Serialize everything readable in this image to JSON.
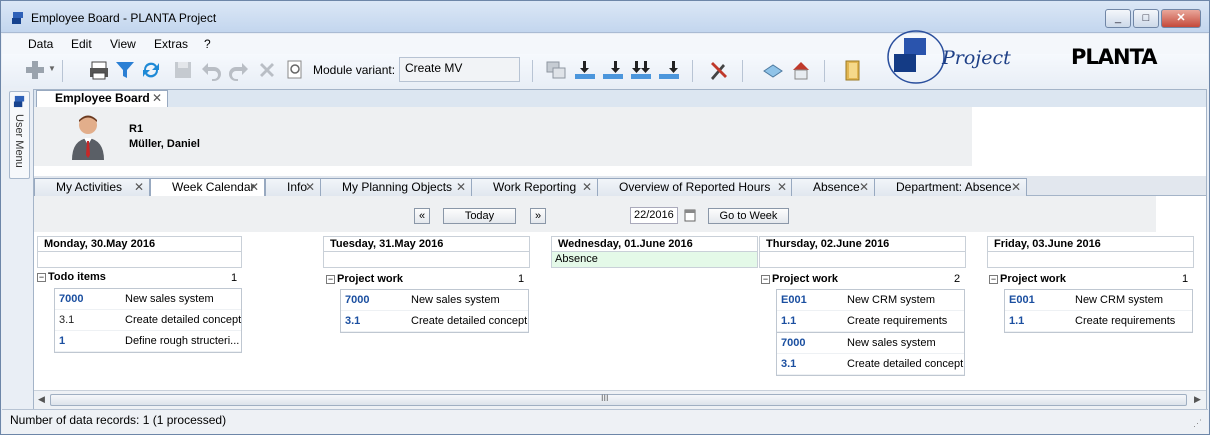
{
  "window": {
    "title": "Employee Board - PLANTA Project",
    "min_icon": "_",
    "max_icon": "□",
    "close_icon": "✕"
  },
  "menu": [
    "Data",
    "Edit",
    "View",
    "Extras",
    "?"
  ],
  "toolbar": {
    "module_variant_label": "Module variant:",
    "module_variant_value": "Create MV",
    "icons": [
      "add-icon",
      "print-icon",
      "filter-icon",
      "refresh-icon",
      "save-icon",
      "undo-icon",
      "redo-icon",
      "delete-icon",
      "preview-icon",
      "module-icon",
      "insert-below-icon",
      "insert-level-icon",
      "insert-sub-icon",
      "insert-end-icon",
      "tools-icon",
      "network-icon",
      "home-icon",
      "folder-icon"
    ]
  },
  "brand": {
    "product_logo_text": "Project",
    "company_logo_text": "PLANTA"
  },
  "side": {
    "label": "User Menu"
  },
  "document": {
    "tab_label": "Employee Board"
  },
  "employee": {
    "id": "R1",
    "name": "Müller, Daniel"
  },
  "tabs": [
    {
      "label": "My Activities"
    },
    {
      "label": "Week Calendar",
      "active": true
    },
    {
      "label": "Info"
    },
    {
      "label": "My Planning Objects"
    },
    {
      "label": "Work Reporting"
    },
    {
      "label": "Overview of Reported Hours"
    },
    {
      "label": "Absence"
    },
    {
      "label": "Department: Absence"
    }
  ],
  "calendar_nav": {
    "prev": "«",
    "today": "Today",
    "next": "»",
    "week": "22/2016",
    "go": "Go to Week"
  },
  "days": [
    {
      "title": "Monday, 30.May 2016",
      "sub": "",
      "group": "Todo items",
      "count": "1",
      "items": [
        {
          "code": "7000",
          "text": "New sales system",
          "link": true
        },
        {
          "code": "3.1",
          "text": "Create detailed concept",
          "link": false
        },
        {
          "code": "1",
          "text": "Define rough structeri...",
          "link": true
        }
      ]
    },
    {
      "title": "Tuesday, 31.May 2016",
      "sub": "",
      "group": "Project work",
      "count": "1",
      "items": [
        {
          "code": "7000",
          "text": "New sales system",
          "link": true
        },
        {
          "code": "3.1",
          "text": "Create detailed concept",
          "link": true
        }
      ]
    },
    {
      "title": "Wednesday, 01.June 2016",
      "sub": "Absence",
      "group": "",
      "count": "",
      "items": []
    },
    {
      "title": "Thursday, 02.June 2016",
      "sub": "",
      "group": "Project work",
      "count": "2",
      "items": [
        {
          "code": "E001",
          "text": "New CRM system",
          "link": true
        },
        {
          "code": "1.1",
          "text": "Create requirements",
          "link": true
        },
        {
          "code": "7000",
          "text": "New sales system",
          "link": true
        },
        {
          "code": "3.1",
          "text": "Create detailed concept",
          "link": true
        }
      ]
    },
    {
      "title": "Friday, 03.June 2016",
      "sub": "",
      "group": "Project work",
      "count": "1",
      "items": [
        {
          "code": "E001",
          "text": "New CRM system",
          "link": true
        },
        {
          "code": "1.1",
          "text": "Create requirements",
          "link": true
        }
      ]
    }
  ],
  "scroll": {
    "grip": "III"
  },
  "status": {
    "text": "Number of data records:  1 (1 processed)"
  }
}
